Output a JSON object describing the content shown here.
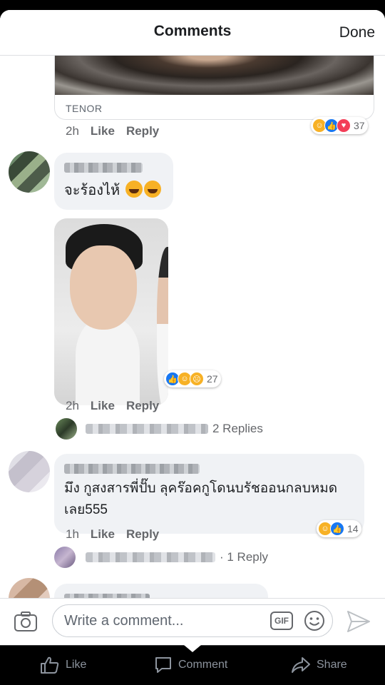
{
  "header": {
    "title": "Comments",
    "done_label": "Done"
  },
  "gif_comment": {
    "source": "TENOR",
    "time": "2h",
    "like_label": "Like",
    "reply_label": "Reply",
    "reaction_count": "37",
    "reactions": [
      "haha",
      "like",
      "love"
    ]
  },
  "comment_1": {
    "text": "จะร้องไห้",
    "emojis": [
      "tears-of-joy",
      "tears-of-joy"
    ],
    "time": "2h",
    "like_label": "Like",
    "reply_label": "Reply",
    "reaction_count": "27",
    "reactions": [
      "like",
      "haha",
      "sad"
    ],
    "replies_label": "2 Replies"
  },
  "comment_2": {
    "text_line1": "มึง กูสงสารพี่ปั๊บ ลุคร๊อคกูโดนบรัชออนกลบหมด",
    "text_line2": "เลย555",
    "time": "1h",
    "like_label": "Like",
    "reply_label": "Reply",
    "reaction_count": "14",
    "reactions": [
      "haha",
      "like"
    ],
    "replies_label": "· 1 Reply"
  },
  "composer": {
    "placeholder": "Write a comment...",
    "gif_label": "GIF"
  },
  "bottom_nav": {
    "like": "Like",
    "comment": "Comment",
    "share": "Share"
  }
}
